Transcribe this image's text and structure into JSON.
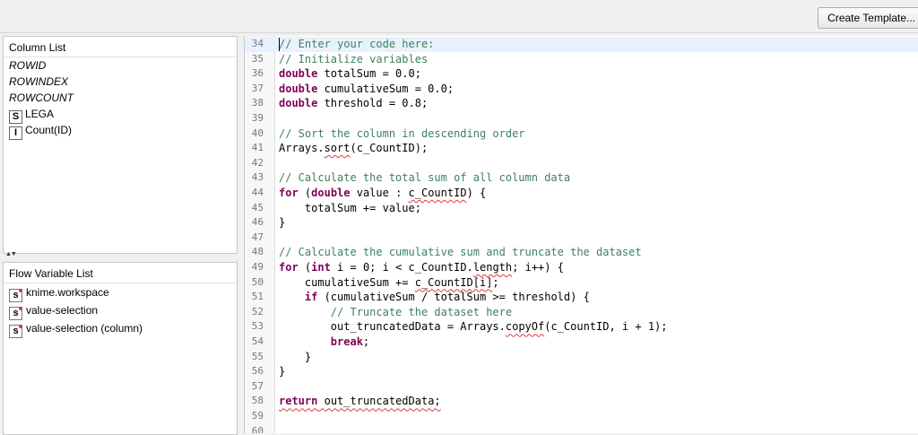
{
  "toolbar": {
    "create_template_label": "Create Template..."
  },
  "column_list": {
    "title": "Column List",
    "items": [
      {
        "label": "ROWID",
        "type": "",
        "italic": true
      },
      {
        "label": "ROWINDEX",
        "type": "",
        "italic": true
      },
      {
        "label": "ROWCOUNT",
        "type": "",
        "italic": true
      },
      {
        "label": "LEGA",
        "type": "S",
        "italic": false
      },
      {
        "label": "Count(ID)",
        "type": "I",
        "italic": false
      }
    ]
  },
  "flow_variable_list": {
    "title": "Flow Variable List",
    "items": [
      {
        "label": "knime.workspace",
        "type": "s"
      },
      {
        "label": "value-selection",
        "type": "s"
      },
      {
        "label": "value-selection (column)",
        "type": "s"
      }
    ]
  },
  "editor": {
    "lines": [
      {
        "n": "34",
        "segments": [
          {
            "t": "// Enter your code here:",
            "c": "cmt"
          }
        ]
      },
      {
        "n": "35",
        "segments": [
          {
            "t": "// Initialize variables",
            "c": "cmt"
          }
        ]
      },
      {
        "n": "36",
        "segments": [
          {
            "t": "double",
            "c": "kw"
          },
          {
            "t": " totalSum = 0.0;"
          }
        ]
      },
      {
        "n": "37",
        "segments": [
          {
            "t": "double",
            "c": "kw"
          },
          {
            "t": " cumulativeSum = 0.0;"
          }
        ]
      },
      {
        "n": "38",
        "segments": [
          {
            "t": "double",
            "c": "kw"
          },
          {
            "t": " threshold = 0.8;"
          }
        ]
      },
      {
        "n": "39",
        "segments": []
      },
      {
        "n": "40",
        "segments": [
          {
            "t": "// Sort the column in descending order",
            "c": "cmt"
          }
        ]
      },
      {
        "n": "41",
        "segments": [
          {
            "t": "Arrays."
          },
          {
            "t": "sort",
            "c": "sq"
          },
          {
            "t": "(c_CountID);"
          }
        ]
      },
      {
        "n": "42",
        "segments": []
      },
      {
        "n": "43",
        "segments": [
          {
            "t": "// Calculate the total sum of all column data",
            "c": "cmt"
          }
        ]
      },
      {
        "n": "44",
        "segments": [
          {
            "t": "for",
            "c": "kw"
          },
          {
            "t": " ("
          },
          {
            "t": "double",
            "c": "kw"
          },
          {
            "t": " value : "
          },
          {
            "t": "c_CountID",
            "c": "sq"
          },
          {
            "t": ") {"
          }
        ]
      },
      {
        "n": "45",
        "segments": [
          {
            "t": "    totalSum += value;"
          }
        ]
      },
      {
        "n": "46",
        "segments": [
          {
            "t": "}"
          }
        ]
      },
      {
        "n": "47",
        "segments": []
      },
      {
        "n": "48",
        "segments": [
          {
            "t": "// Calculate the cumulative sum and truncate the dataset",
            "c": "cmt"
          }
        ]
      },
      {
        "n": "49",
        "segments": [
          {
            "t": "for",
            "c": "kw"
          },
          {
            "t": " ("
          },
          {
            "t": "int",
            "c": "kw"
          },
          {
            "t": " i = 0; i < c_CountID."
          },
          {
            "t": "length",
            "c": "sq"
          },
          {
            "t": "; i++) {"
          }
        ]
      },
      {
        "n": "50",
        "segments": [
          {
            "t": "    cumulativeSum += "
          },
          {
            "t": "c_CountID[i]",
            "c": "sq"
          },
          {
            "t": ";"
          }
        ]
      },
      {
        "n": "51",
        "segments": [
          {
            "t": "    "
          },
          {
            "t": "if",
            "c": "kw"
          },
          {
            "t": " (cumulativeSum / totalSum >= threshold) {"
          }
        ]
      },
      {
        "n": "52",
        "segments": [
          {
            "t": "        // Truncate the dataset here",
            "c": "cmt"
          }
        ]
      },
      {
        "n": "53",
        "segments": [
          {
            "t": "        out_truncatedData = Arrays."
          },
          {
            "t": "copyOf",
            "c": "sq"
          },
          {
            "t": "(c_CountID, i + 1);"
          }
        ]
      },
      {
        "n": "54",
        "segments": [
          {
            "t": "        "
          },
          {
            "t": "break",
            "c": "kw"
          },
          {
            "t": ";"
          }
        ]
      },
      {
        "n": "55",
        "segments": [
          {
            "t": "    }"
          }
        ]
      },
      {
        "n": "56",
        "segments": [
          {
            "t": "}"
          }
        ]
      },
      {
        "n": "57",
        "segments": []
      },
      {
        "n": "58",
        "segments": [
          {
            "t": "return",
            "c": "kw sq"
          },
          {
            "t": " ",
            "c": "sq"
          },
          {
            "t": "out_truncatedData;",
            "c": "sq"
          }
        ]
      },
      {
        "n": "59",
        "segments": []
      },
      {
        "n": "60",
        "segments": []
      }
    ]
  }
}
